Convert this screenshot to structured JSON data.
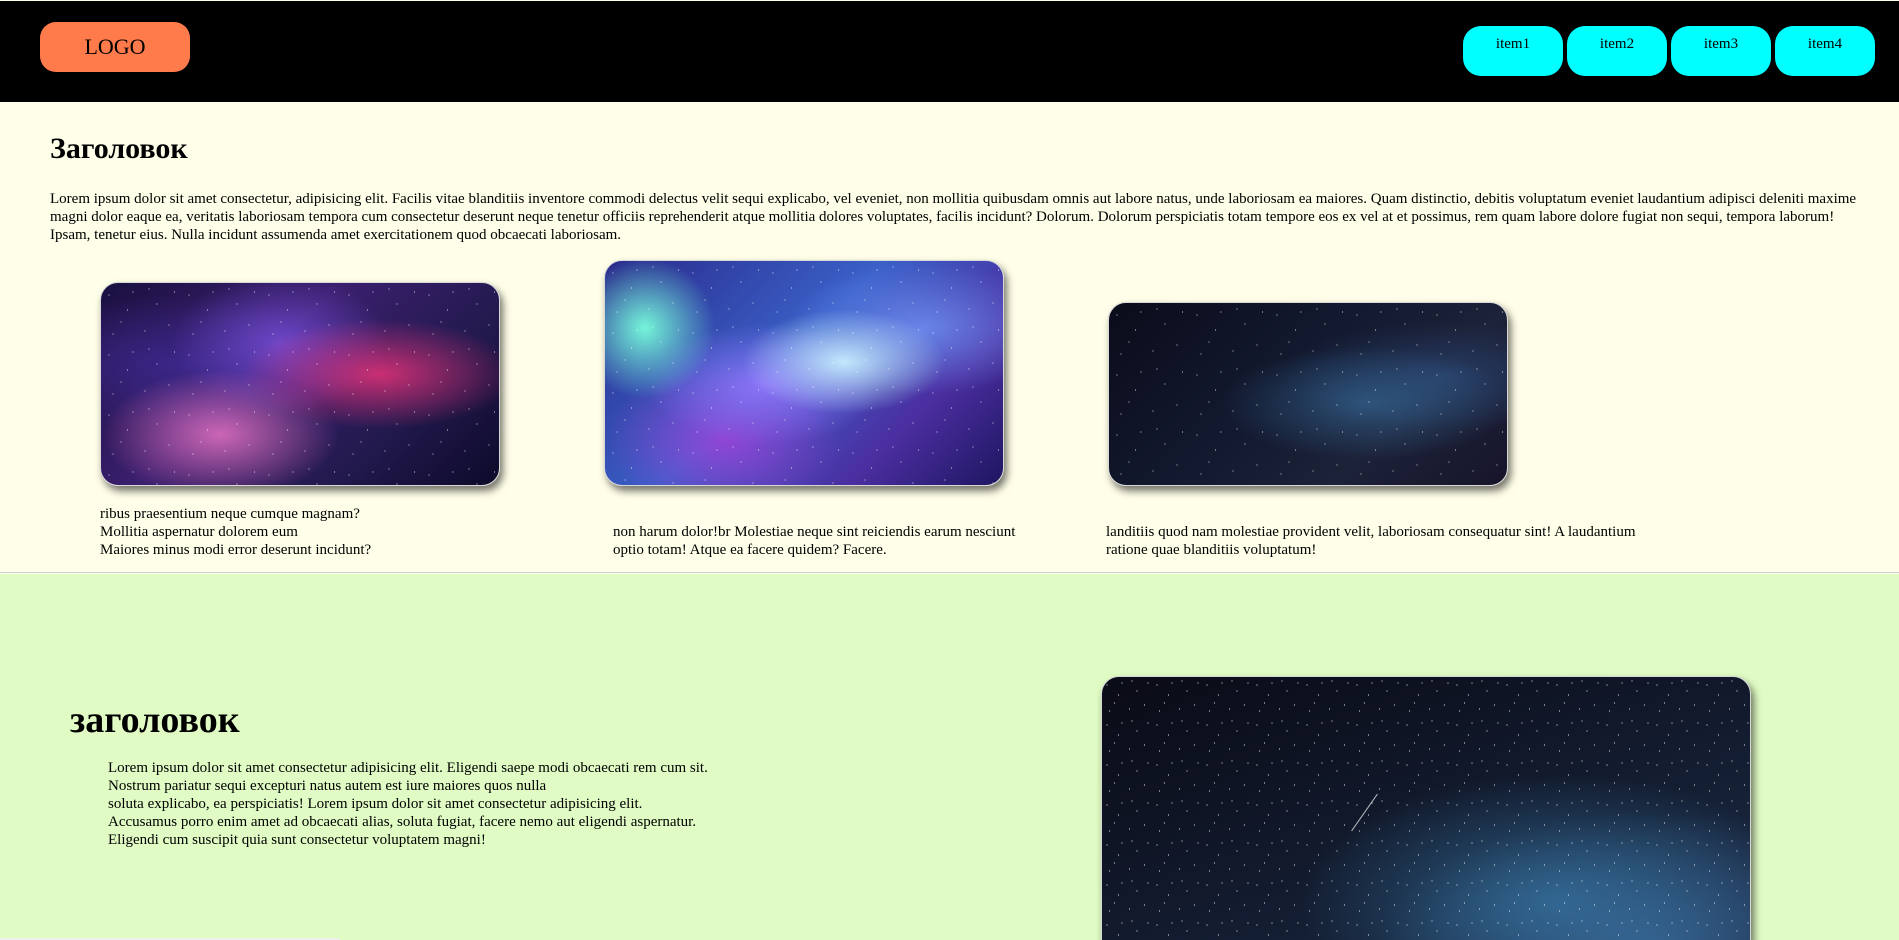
{
  "header": {
    "logo": "LOGO",
    "nav": [
      "item1",
      "item2",
      "item3",
      "item4"
    ]
  },
  "section1": {
    "title": "Заголовок",
    "intro": "Lorem ipsum dolor sit amet consectetur, adipisicing elit. Facilis vitae blanditiis inventore commodi delectus velit sequi explicabo, vel eveniet, non mollitia quibusdam omnis aut labore natus, unde laboriosam ea maiores. Quam distinctio, debitis voluptatum eveniet laudantium adipisci deleniti maxime magni dolor eaque ea, veritatis laboriosam tempora cum consectetur deserunt neque tenetur officiis reprehenderit atque mollitia dolores voluptates, facilis incidunt? Dolorum. Dolorum perspiciatis totam tempore eos ex vel at et possimus, rem quam labore dolore fugiat non sequi, tempora laborum! Ipsam, tenetur eius. Nulla incidunt assumenda amet exercitationem quod obcaecati laboriosam.",
    "cards": [
      {
        "caption_lines": [
          "ribus praesentium neque cumque magnam?",
          "Mollitia aspernatur dolorem eum",
          "Maiores minus modi error deserunt incidunt?"
        ]
      },
      {
        "caption_lines": [
          "non harum dolor!br Molestiae neque sint reiciendis earum nesciunt",
          "optio totam! Atque ea facere quidem? Facere."
        ]
      },
      {
        "caption_lines": [
          "landitiis quod nam molestiae provident velit, laboriosam consequatur sint! A laudantium",
          "ratione quae blanditiis voluptatum!"
        ]
      }
    ]
  },
  "section2": {
    "title": "заголовок",
    "body_lines": [
      "Lorem ipsum dolor sit amet consectetur adipisicing elit. Eligendi saepe modi obcaecati rem cum sit.",
      "Nostrum pariatur sequi excepturi natus autem est iure maiores quos nulla",
      "soluta explicabo, ea perspiciatis! Lorem ipsum dolor sit amet consectetur adipisicing elit.",
      "Accusamus porro enim amet ad obcaecati alias, soluta fugiat, facere nemo aut eligendi aspernatur.",
      "Eligendi cum suscipit quia sunt consectetur voluptatem magni!"
    ]
  },
  "colors": {
    "header_bg": "#000000",
    "logo_bg": "#ff7b4b",
    "nav_bg": "#00ffff",
    "section1_bg": "#fffee8",
    "section2_bg": "#e0fcc4"
  }
}
